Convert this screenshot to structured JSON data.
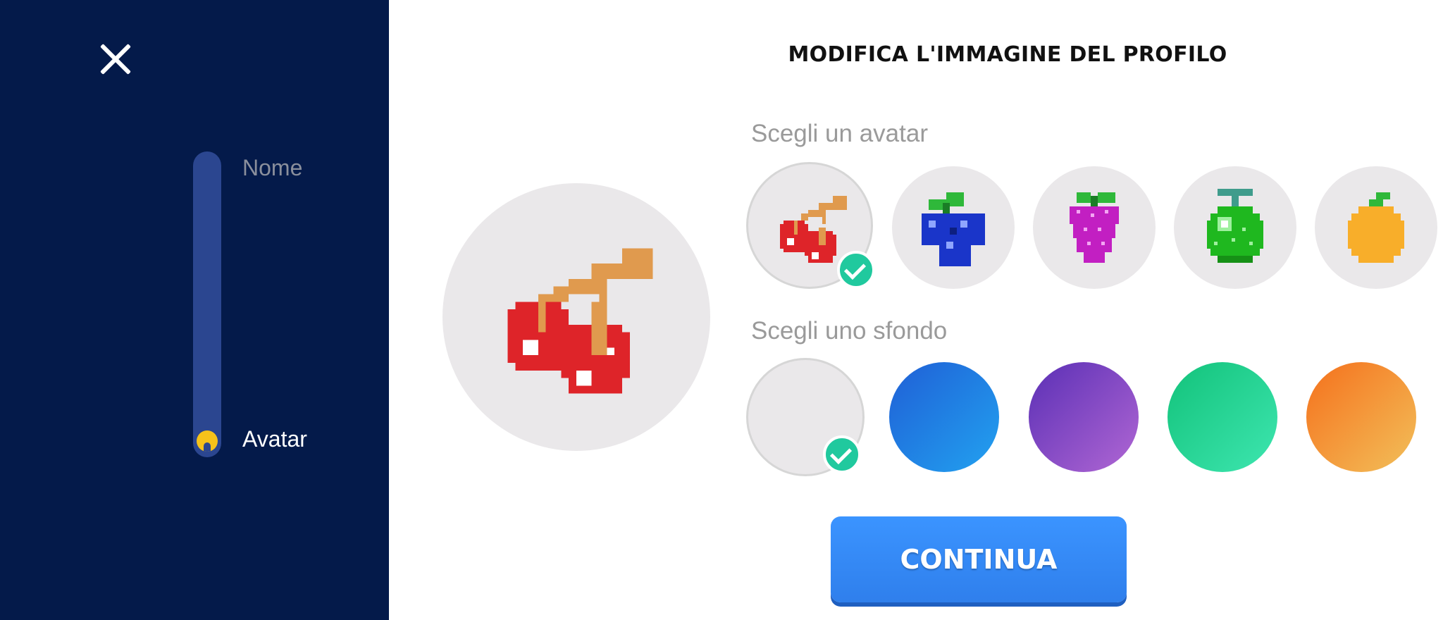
{
  "sidebar": {
    "close_icon": "close-icon",
    "steps": [
      {
        "label": "Nome",
        "active": false
      },
      {
        "label": "Avatar",
        "active": true
      }
    ],
    "progress_indicator_icon": "pacman-icon"
  },
  "main": {
    "title": "MODIFICA L'IMMAGINE DEL PROFILO",
    "avatar_section_label": "Scegli un avatar",
    "background_section_label": "Scegli uno sfondo",
    "continue_label": "CONTINUA"
  },
  "avatars": [
    {
      "name": "cherries-icon",
      "selected": true
    },
    {
      "name": "blueberries-icon",
      "selected": false
    },
    {
      "name": "grapes-icon",
      "selected": false
    },
    {
      "name": "melon-icon",
      "selected": false
    },
    {
      "name": "orange-icon",
      "selected": false
    }
  ],
  "backgrounds": [
    {
      "colors": [
        "#eae8ea",
        "#eae8ea"
      ],
      "selected": true
    },
    {
      "colors": [
        "#1f5fd6",
        "#22a2f0"
      ],
      "selected": false
    },
    {
      "colors": [
        "#5a2fb5",
        "#b167d4"
      ],
      "selected": false
    },
    {
      "colors": [
        "#12c27a",
        "#3ee6b0"
      ],
      "selected": false
    },
    {
      "colors": [
        "#f5701c",
        "#f2c05a"
      ],
      "selected": false
    }
  ],
  "colors": {
    "sidebar_bg": "#041a4a",
    "accent": "#2f7fec",
    "check": "#20c99e"
  }
}
